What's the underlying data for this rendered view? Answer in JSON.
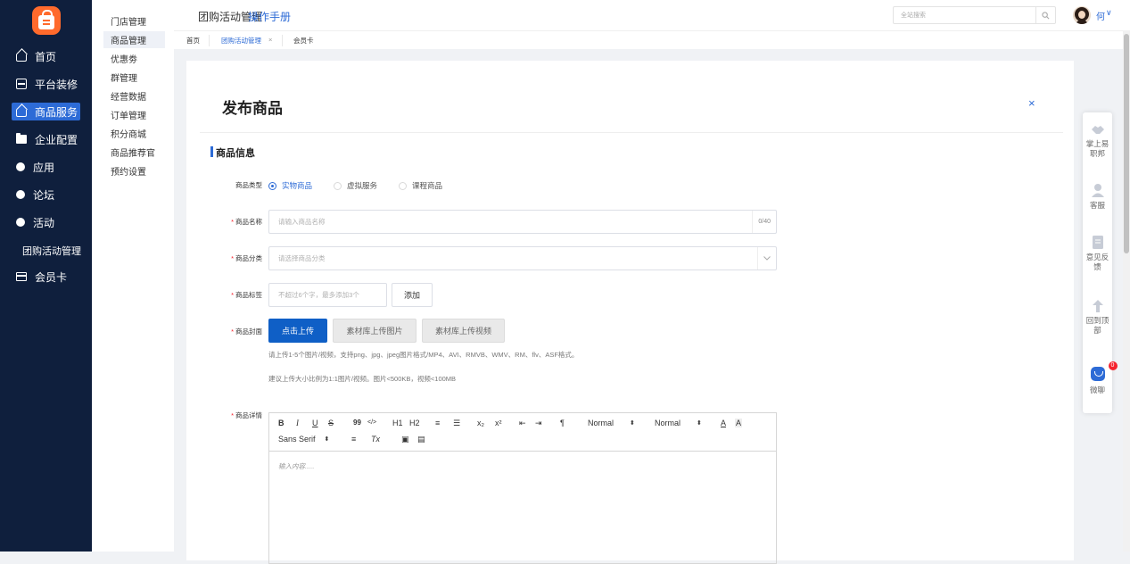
{
  "sidebar": {
    "items": [
      {
        "label": "首页"
      },
      {
        "label": "平台装修"
      },
      {
        "label": "商品服务"
      },
      {
        "label": "企业配置"
      },
      {
        "label": "应用"
      },
      {
        "label": "论坛"
      },
      {
        "label": "活动"
      },
      {
        "label": "团购活动管理"
      },
      {
        "label": "会员卡"
      }
    ],
    "active": "商品服务"
  },
  "submenu": {
    "items": [
      "门店管理",
      "商品管理",
      "优惠劵",
      "群管理",
      "经营数据",
      "订单管理",
      "积分商城",
      "商品推荐官",
      "预约设置"
    ],
    "active": "商品管理"
  },
  "header": {
    "title": "团购活动管理",
    "manual_link": "操作手册",
    "search_placeholder": "全站搜索",
    "username": "何",
    "caret": "∨"
  },
  "tabs": [
    {
      "label": "首页"
    },
    {
      "label": "团购活动管理",
      "close": "×"
    },
    {
      "label": "会员卡"
    }
  ],
  "page": {
    "title": "发布商品",
    "close": "×",
    "section_title": "商品信息"
  },
  "form": {
    "type_label": "商品类型",
    "type_options": [
      "实物商品",
      "虚拟服务",
      "课程商品"
    ],
    "type_selected": "实物商品",
    "name_label": "商品名称",
    "name_placeholder": "请输入商品名称",
    "name_counter": "0/40",
    "category_label": "商品分类",
    "category_placeholder": "请选择商品分类",
    "tag_label": "商品标签",
    "tag_placeholder": "不超过6个字，最多添加3个",
    "tag_add_button": "添加",
    "cover_label": "商品封面",
    "cover_upload_button": "点击上传",
    "cover_lib_image_button": "素材库上传图片",
    "cover_lib_video_button": "素材库上传视频",
    "cover_hint_1": "请上传1-5个图片/视频，支持png、jpg、jpeg图片格式/MP4、AVI、RMVB、WMV、RM、flv、ASF格式。",
    "cover_hint_2": "建议上传大小比例为1:1图片/视频。图片<500KB，视频<100MB",
    "detail_label": "商品详情",
    "required_mark": "*"
  },
  "editor": {
    "toolbar": {
      "bold": "B",
      "italic": "I",
      "underline": "U",
      "strike": "S",
      "quote": "99",
      "code": "</>",
      "h1": "H1",
      "h2": "H2",
      "ordered_list": "≡",
      "bullet_list": "☰",
      "subscript": "x₂",
      "superscript": "x²",
      "outdent": "⇤",
      "indent": "⇥",
      "direction": "¶",
      "size_select": "Normal",
      "header_select": "Normal",
      "font_color": "A",
      "background_color": "A",
      "font_select": "Sans Serif",
      "align": "≡",
      "clean": "Tx",
      "image": "▣",
      "video": "▤"
    },
    "placeholder": "输入内容....."
  },
  "float_panel": {
    "items": [
      {
        "label": "掌上易职邦",
        "icon": "handshake-icon"
      },
      {
        "label": "客服",
        "icon": "user-service-icon"
      },
      {
        "label": "意见反馈",
        "icon": "feedback-icon"
      },
      {
        "label": "回到顶部",
        "icon": "arrow-up-icon"
      },
      {
        "label": "微聊",
        "icon": "chat-icon",
        "badge": "0"
      }
    ]
  },
  "colors": {
    "sidebar_bg": "#0f1f3d",
    "accent": "#2d6bd6",
    "primary_button": "#0f5fc6",
    "logo": "#ff6a2c",
    "required": "#f5222d"
  }
}
